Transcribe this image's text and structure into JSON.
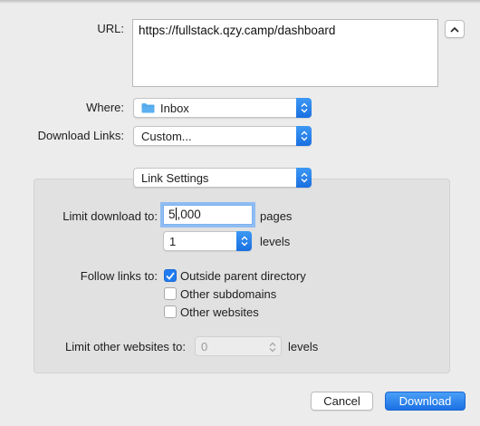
{
  "url": {
    "label": "URL:",
    "value": "https://fullstack.qzy.camp/dashboard"
  },
  "where": {
    "label": "Where:",
    "value": "Inbox",
    "icon": "folder-icon"
  },
  "download_links": {
    "label": "Download Links:",
    "value": "Custom..."
  },
  "link_settings": {
    "value": "Link Settings"
  },
  "limit_download": {
    "label": "Limit download to:",
    "pages_before_caret": "5",
    "pages_after_caret": ",000",
    "pages_unit": "pages",
    "levels_value": "1",
    "levels_unit": "levels"
  },
  "follow_links": {
    "label": "Follow links to:",
    "options": [
      {
        "label": "Outside parent directory",
        "checked": true
      },
      {
        "label": "Other subdomains",
        "checked": false
      },
      {
        "label": "Other websites",
        "checked": false
      }
    ]
  },
  "limit_other": {
    "label": "Limit other websites to:",
    "value": "0",
    "unit": "levels",
    "enabled": false
  },
  "buttons": {
    "cancel": "Cancel",
    "download": "Download"
  },
  "colors": {
    "accent": "#1f7bf0",
    "background": "#ececec",
    "panel": "#e1e1e1"
  }
}
